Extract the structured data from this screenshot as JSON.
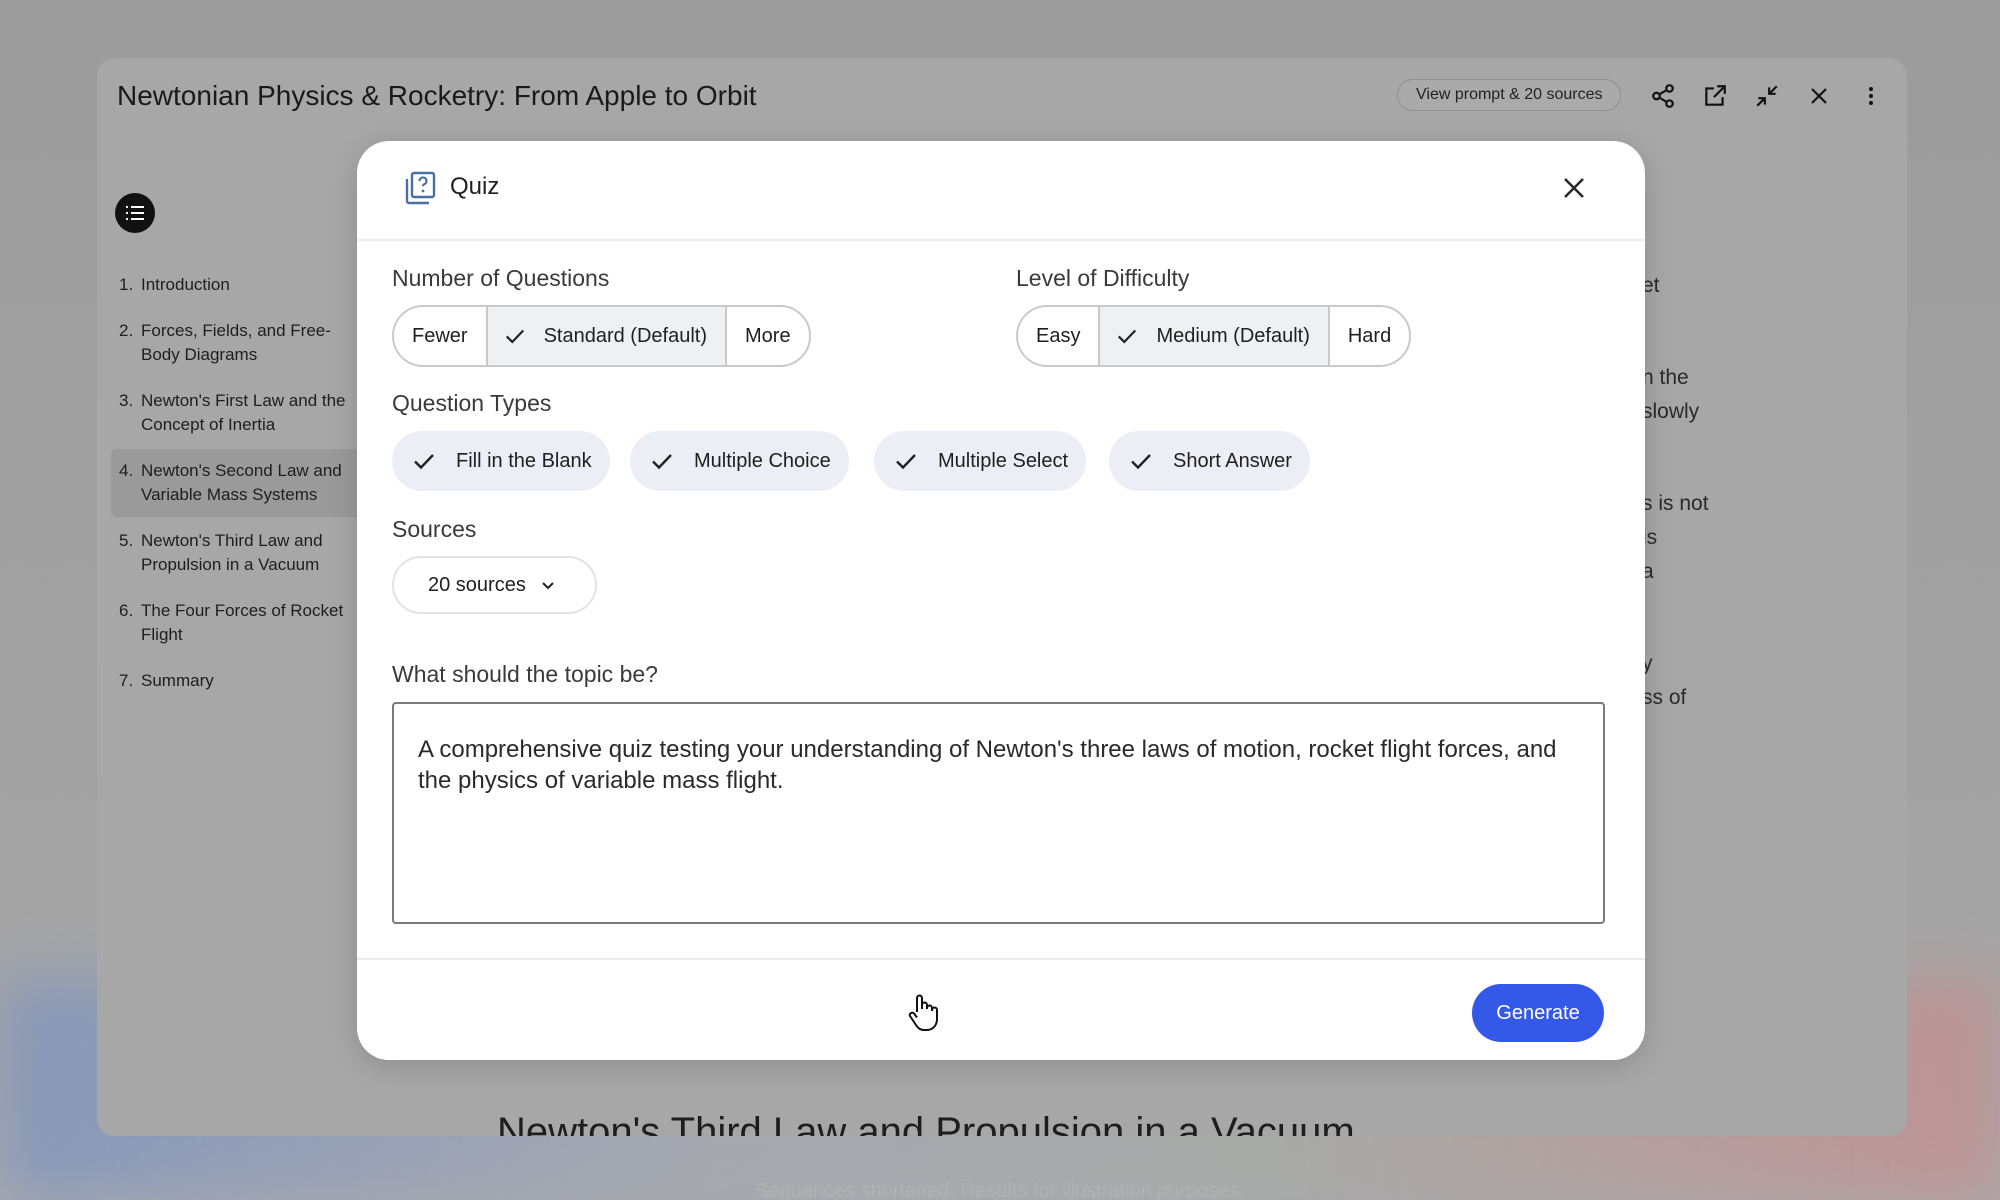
{
  "app": {
    "title": "Newtonian Physics & Rocketry: From Apple to Orbit",
    "view_prompt_label": "View prompt & 20 sources",
    "icons": [
      "share-icon",
      "open-in-new-icon",
      "collapse-icon",
      "close-icon",
      "more-vert-icon"
    ]
  },
  "toc": [
    {
      "num": "1.",
      "label": "Introduction"
    },
    {
      "num": "2.",
      "label": "Forces, Fields, and Free-Body Diagrams"
    },
    {
      "num": "3.",
      "label": "Newton's First Law and the Concept of Inertia"
    },
    {
      "num": "4.",
      "label": "Newton's Second Law and Variable Mass Systems"
    },
    {
      "num": "5.",
      "label": "Newton's Third Law and Propulsion in a Vacuum"
    },
    {
      "num": "6.",
      "label": "The Four Forces of Rocket Flight"
    },
    {
      "num": "7.",
      "label": "Summary"
    }
  ],
  "background_text": {
    "right_fragments": [
      "et",
      "n the",
      "slowly",
      "s is not",
      "is",
      "a",
      "y",
      "ss of"
    ],
    "bottom_heading": "Newton's Third Law and Propulsion in a Vacuum",
    "footer_note": "Sequences shortened. Results for illustration purposes."
  },
  "modal": {
    "title": "Quiz",
    "num_questions": {
      "label": "Number of Questions",
      "options": [
        "Fewer",
        "Standard (Default)",
        "More"
      ],
      "selected": "Standard (Default)"
    },
    "difficulty": {
      "label": "Level of Difficulty",
      "options": [
        "Easy",
        "Medium (Default)",
        "Hard"
      ],
      "selected": "Medium (Default)"
    },
    "question_types": {
      "label": "Question Types",
      "items": [
        "Fill in the Blank",
        "Multiple Choice",
        "Multiple Select",
        "Short Answer"
      ]
    },
    "sources": {
      "label": "Sources",
      "value": "20 sources"
    },
    "topic": {
      "label": "What should the topic be?",
      "value": "A comprehensive quiz testing your understanding of Newton's three laws of motion, rocket flight forces, and the physics of variable mass flight."
    },
    "generate_label": "Generate"
  },
  "colors": {
    "accent": "#3458e8",
    "chip_bg": "#eceef5",
    "selected_seg_bg": "#eef0f4"
  }
}
